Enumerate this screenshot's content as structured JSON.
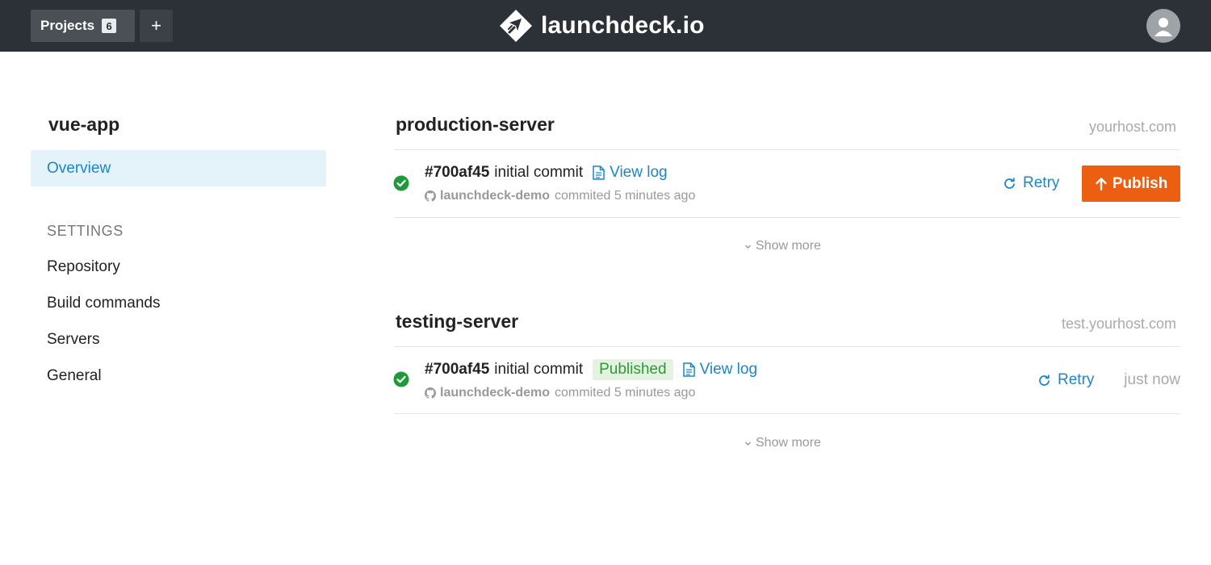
{
  "header": {
    "projects_label": "Projects",
    "projects_count": "6",
    "add_label": "+",
    "brand_name": "launchdeck.io"
  },
  "sidebar": {
    "project_name": "vue-app",
    "overview_label": "Overview",
    "settings_header": "SETTINGS",
    "settings_links": [
      "Repository",
      "Build commands",
      "Servers",
      "General"
    ]
  },
  "servers": [
    {
      "name": "production-server",
      "host": "yourhost.com",
      "commit_hash": "#700af45",
      "commit_message": "initial commit",
      "view_log_label": "View log",
      "author": "launchdeck-demo",
      "author_suffix": "commited 5 minutes ago",
      "retry_label": "Retry",
      "publish_label": "Publish",
      "show_more_label": "Show more"
    },
    {
      "name": "testing-server",
      "host": "test.yourhost.com",
      "commit_hash": "#700af45",
      "commit_message": "initial commit",
      "status_badge": "Published",
      "view_log_label": "View log",
      "author": "launchdeck-demo",
      "author_suffix": "commited 5 minutes ago",
      "retry_label": "Retry",
      "published_time": "just now",
      "show_more_label": "Show more"
    }
  ],
  "colors": {
    "topbar": "#2c3138",
    "accent": "#1c86c7",
    "publish": "#ec5e10",
    "success": "#1e9a3a",
    "overview_bg": "#e4f2fa"
  },
  "icons": {
    "status": "check-circle-icon",
    "log": "document-icon",
    "author": "github-icon",
    "retry": "refresh-icon",
    "publish": "arrow-up-icon",
    "show_more": "chevron-down-icon"
  }
}
